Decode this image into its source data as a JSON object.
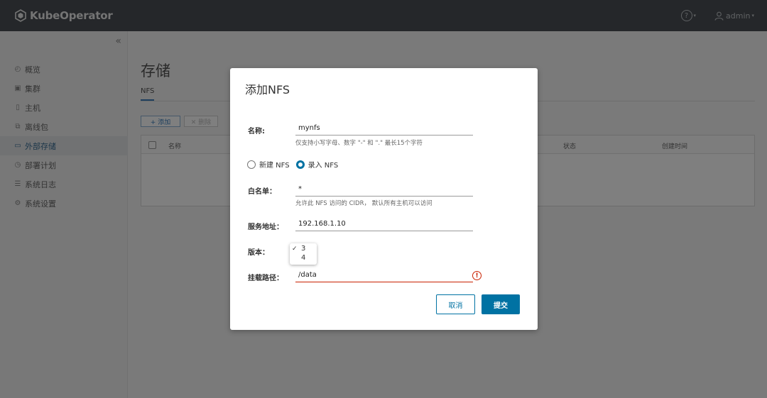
{
  "header": {
    "app_name": "KubeOperator",
    "help_icon": "help-circle-icon",
    "user_label": "admin"
  },
  "sidebar": {
    "collapse_glyph": "«",
    "items": [
      {
        "label": "概览",
        "icon": "dashboard-icon"
      },
      {
        "label": "集群",
        "icon": "cluster-icon"
      },
      {
        "label": "主机",
        "icon": "host-icon"
      },
      {
        "label": "离线包",
        "icon": "package-icon"
      },
      {
        "label": "外部存储",
        "icon": "storage-icon",
        "active": true
      },
      {
        "label": "部署计划",
        "icon": "plan-icon"
      },
      {
        "label": "系统日志",
        "icon": "log-icon"
      },
      {
        "label": "系统设置",
        "icon": "settings-icon"
      }
    ]
  },
  "main": {
    "title": "存储",
    "tab": "NFS",
    "add_button": "+ 添加",
    "delete_button": "✕ 删除",
    "columns": [
      "名称",
      "状态",
      "创建时间"
    ]
  },
  "modal": {
    "title": "添加NFS",
    "name_label": "名称:",
    "name_value": "mynfs",
    "name_helper": "仅支持小写字母、数字 \"-\" 和 \".\" 最长15个字符",
    "radio_new": "新建 NFS",
    "radio_import": "录入 NFS",
    "selected_mode": "录入 NFS",
    "whitelist_label": "白名单：",
    "whitelist_value": "*",
    "whitelist_helper": "允许此 NFS 访问的 CIDR， 默认所有主机可以访问",
    "server_label": "服务地址：",
    "server_value": "192.168.1.10",
    "version_label": "版本：",
    "version_options": [
      "3",
      "4"
    ],
    "version_selected": "3",
    "check_glyph": "✓",
    "mount_label": "挂载路径：",
    "mount_value": "/data",
    "error_glyph": "!",
    "cancel_button": "取消",
    "submit_button": "提交",
    "accent_color": "#0072a3",
    "error_color": "#c92100"
  }
}
